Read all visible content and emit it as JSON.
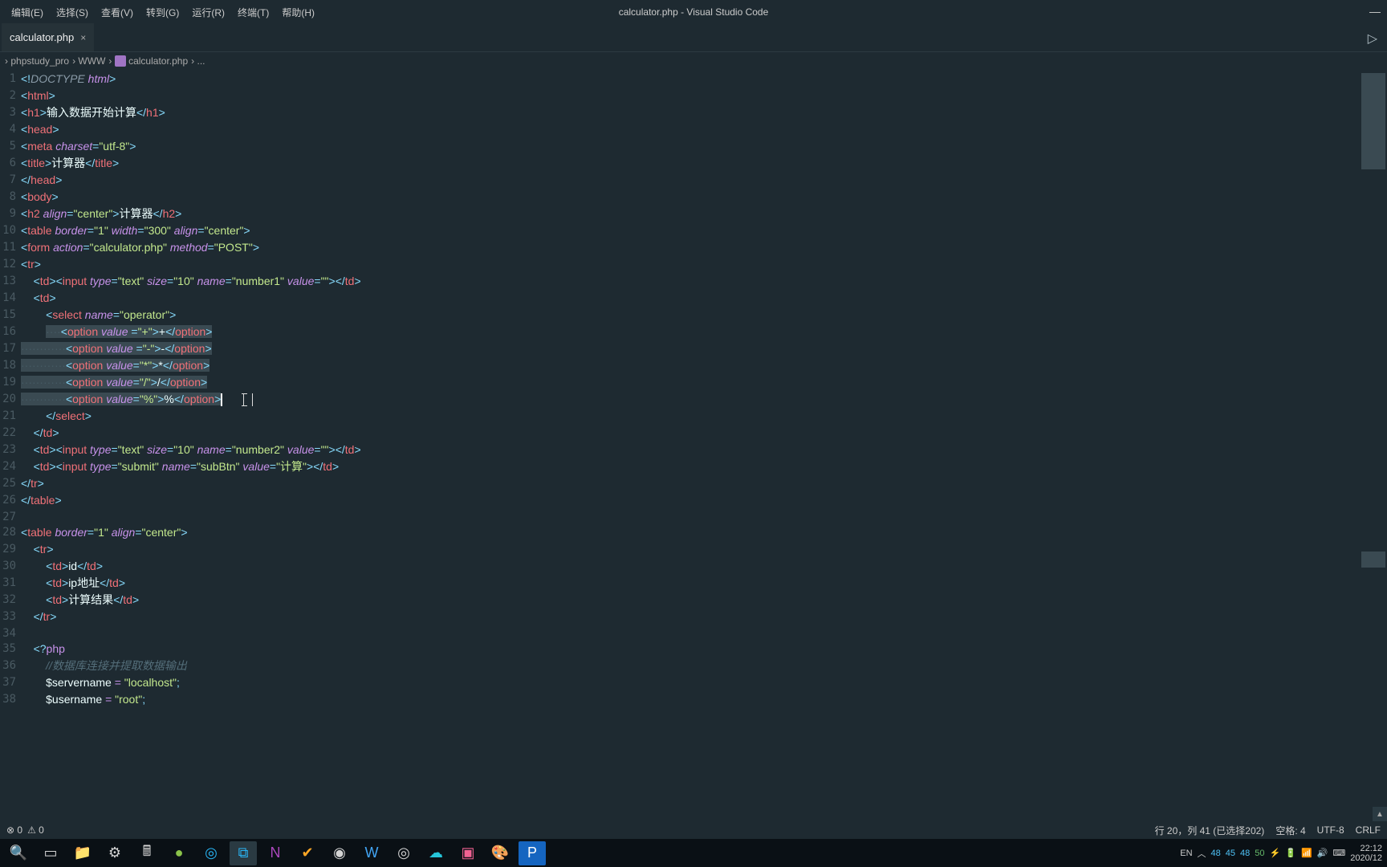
{
  "window": {
    "title": "calculator.php - Visual Studio Code",
    "minimize": "—"
  },
  "menu": {
    "items": [
      "编辑(E)",
      "选择(S)",
      "查看(V)",
      "转到(G)",
      "运行(R)",
      "终端(T)",
      "帮助(H)"
    ]
  },
  "tab": {
    "name": "calculator.php",
    "close": "×",
    "run": "▷"
  },
  "breadcrumb": {
    "a": "phpstudy_pro",
    "b": "WWW",
    "c": "calculator.php",
    "d": "...",
    "sep": "›"
  },
  "lines": {
    "start": 1,
    "end": 38
  },
  "code": {
    "l1a": "<!",
    "l1b": "DOCTYPE ",
    "l1c": "html",
    "l1d": ">",
    "l2a": "<",
    "l2b": "html",
    "l2c": ">",
    "l3a": "<",
    "l3b": "h1",
    "l3c": ">",
    "l3d": "输入数据开始计算",
    "l3e": "</",
    "l3f": "h1",
    "l3g": ">",
    "l4a": "<",
    "l4b": "head",
    "l4c": ">",
    "l5a": "<",
    "l5b": "meta ",
    "l5c": "charset",
    "l5d": "=",
    "l5e": "\"utf-8\"",
    "l5f": ">",
    "l6a": "<",
    "l6b": "title",
    "l6c": ">",
    "l6d": "计算器",
    "l6e": "</",
    "l6f": "title",
    "l6g": ">",
    "l7a": "</",
    "l7b": "head",
    "l7c": ">",
    "l8a": "<",
    "l8b": "body",
    "l8c": ">",
    "l9a": "<",
    "l9b": "h2 ",
    "l9c": "align",
    "l9d": "=",
    "l9e": "\"center\"",
    "l9f": ">",
    "l9g": "计算器",
    "l9h": "</",
    "l9i": "h2",
    "l9j": ">",
    "l10a": "<",
    "l10b": "table ",
    "l10c": "border",
    "l10d": "=",
    "l10e": "\"1\" ",
    "l10f": "width",
    "l10g": "=",
    "l10h": "\"300\" ",
    "l10i": "align",
    "l10j": "=",
    "l10k": "\"center\"",
    "l10l": ">",
    "l11a": "<",
    "l11b": "form ",
    "l11c": "action",
    "l11d": "=",
    "l11e": "\"calculator.php\" ",
    "l11f": "method",
    "l11g": "=",
    "l11h": "\"POST\"",
    "l11i": ">",
    "l12a": "<",
    "l12b": "tr",
    "l12c": ">",
    "ind4": "    ",
    "ind8": "        ",
    "ind12": "            ",
    "l13a": "<",
    "l13b": "td",
    "l13c": "><",
    "l13d": "input ",
    "l13e": "type",
    "l13f": "=",
    "l13g": "\"text\" ",
    "l13h": "size",
    "l13i": "=",
    "l13j": "\"10\" ",
    "l13k": "name",
    "l13l": "=",
    "l13m": "\"number1\" ",
    "l13n": "value",
    "l13o": "=",
    "l13p": "\"\"",
    "l13q": "></",
    "l13r": "td",
    "l13s": ">",
    "l14a": "<",
    "l14b": "td",
    "l14c": ">",
    "l15a": "<",
    "l15b": "select ",
    "l15c": "name",
    "l15d": "=",
    "l15e": "\"operator\"",
    "l15f": ">",
    "dots12": "············",
    "dots4": "····",
    "opt_a": "<",
    "opt_b": "option ",
    "opt_c": "value ",
    "opt_c2": "value",
    "opt_d": "=",
    "opt_e": ">",
    "opt_f": "</",
    "opt_g": "option",
    "opt_h": ">",
    "v16": "\"+\"",
    "t16": "+",
    "v17": "\"-\"",
    "t17": "-",
    "v18": "\"*\"",
    "t18": "*",
    "v19": "\"/\"",
    "t19": "/",
    "v20": "\"%\"",
    "t20": "%",
    "l21a": "</",
    "l21b": "select",
    "l21c": ">",
    "l22a": "</",
    "l22b": "td",
    "l22c": ">",
    "l23a": "<",
    "l23b": "td",
    "l23c": "><",
    "l23d": "input ",
    "l23e": "type",
    "l23f": "=",
    "l23g": "\"text\" ",
    "l23h": "size",
    "l23i": "=",
    "l23j": "\"10\" ",
    "l23k": "name",
    "l23l": "=",
    "l23m": "\"number2\" ",
    "l23n": "value",
    "l23o": "=",
    "l23p": "\"\"",
    "l23q": "></",
    "l23r": "td",
    "l23s": ">",
    "l24a": "<",
    "l24b": "td",
    "l24c": "><",
    "l24d": "input ",
    "l24e": "type",
    "l24f": "=",
    "l24g": "\"submit\" ",
    "l24h": "name",
    "l24i": "=",
    "l24j": "\"subBtn\" ",
    "l24k": "value",
    "l24l": "=",
    "l24m": "\"计算\"",
    "l24n": "></",
    "l24o": "td",
    "l24p": ">",
    "l25a": "</",
    "l25b": "tr",
    "l25c": ">",
    "l26a": "</",
    "l26b": "table",
    "l26c": ">",
    "l28a": "<",
    "l28b": "table ",
    "l28c": "border",
    "l28d": "=",
    "l28e": "\"1\" ",
    "l28f": "align",
    "l28g": "=",
    "l28h": "\"center\"",
    "l28i": ">",
    "l29a": "<",
    "l29b": "tr",
    "l29c": ">",
    "l30a": "<",
    "l30b": "td",
    "l30c": ">",
    "l30d": "id",
    "l30e": "</",
    "l30f": "td",
    "l30g": ">",
    "l31a": "<",
    "l31b": "td",
    "l31c": ">",
    "l31d": "ip地址",
    "l31e": "</",
    "l31f": "td",
    "l31g": ">",
    "l32a": "<",
    "l32b": "td",
    "l32c": ">",
    "l32d": "计算结果",
    "l32e": "</",
    "l32f": "td",
    "l32g": ">",
    "l33a": "</",
    "l33b": "tr",
    "l33c": ">",
    "l35a": "<?",
    "l35b": "php",
    "l36": "//数据库连接并提取数据输出",
    "l37a": "$servername ",
    "l37b": "= ",
    "l37c": "\"localhost\"",
    "l37d": ";",
    "l38a": "$username ",
    "l38b": "= ",
    "l38c": "\"root\"",
    "l38d": ";"
  },
  "status": {
    "errors": "⊗ 0",
    "warnings": "⚠ 0",
    "pos": "行 20，列 41 (已选择202)",
    "spaces": "空格: 4",
    "enc": "UTF-8",
    "eol": "CRLF"
  },
  "tray": {
    "ime": "EN",
    "up": "︿",
    "n1": "48",
    "n2": "45",
    "n3": "48",
    "n4": "50",
    "time": "22:12",
    "date": "2020/12"
  },
  "taskbar_icons": [
    "search",
    "taskview",
    "file-explorer",
    "settings",
    "calc",
    "browser-360",
    "edge",
    "vscode",
    "onenote",
    "check",
    "chrome",
    "word",
    "target",
    "flow",
    "bili",
    "paint",
    "photoshop"
  ]
}
